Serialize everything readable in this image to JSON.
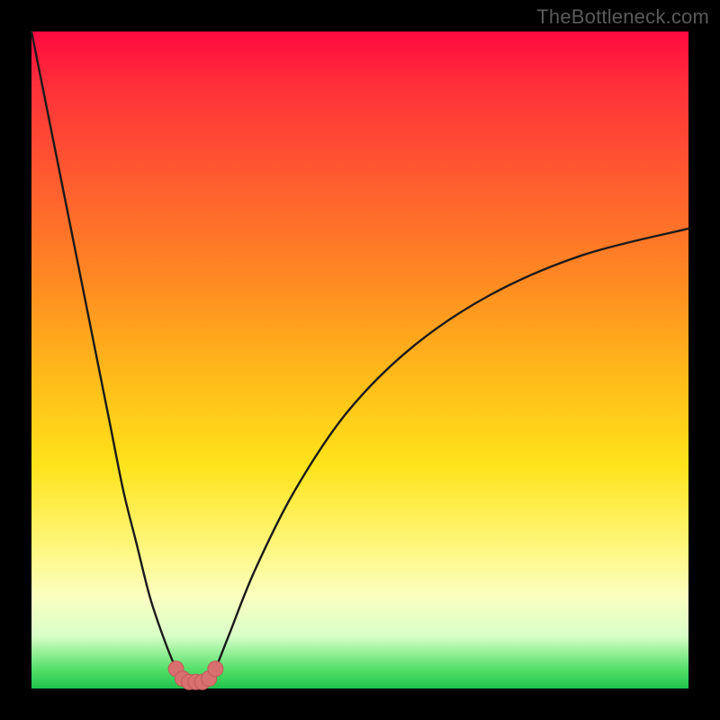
{
  "watermark": "TheBottleneck.com",
  "colors": {
    "background": "#000000",
    "curve_stroke": "#1a1a1a",
    "marker_fill": "#d97070",
    "marker_stroke": "#c05858"
  },
  "chart_data": {
    "type": "line",
    "title": "",
    "xlabel": "",
    "ylabel": "",
    "ylim": [
      0,
      100
    ],
    "series": [
      {
        "name": "bottleneck-curve",
        "x": [
          0,
          2,
          4,
          6,
          8,
          10,
          12,
          14,
          16,
          18,
          20,
          22,
          23,
          24,
          25,
          26,
          27,
          28,
          30,
          34,
          40,
          48,
          58,
          70,
          84,
          100
        ],
        "values": [
          100,
          90,
          80,
          70,
          60,
          50,
          40,
          30,
          22,
          14,
          8,
          3,
          1.5,
          1,
          1,
          1,
          1.5,
          3,
          8,
          18,
          30,
          42,
          52,
          60,
          66,
          70
        ]
      }
    ],
    "markers": {
      "name": "valley-markers",
      "x": [
        22,
        23,
        24,
        25,
        26,
        27,
        28
      ],
      "values": [
        3,
        1.5,
        1,
        1,
        1,
        1.5,
        3
      ]
    }
  }
}
